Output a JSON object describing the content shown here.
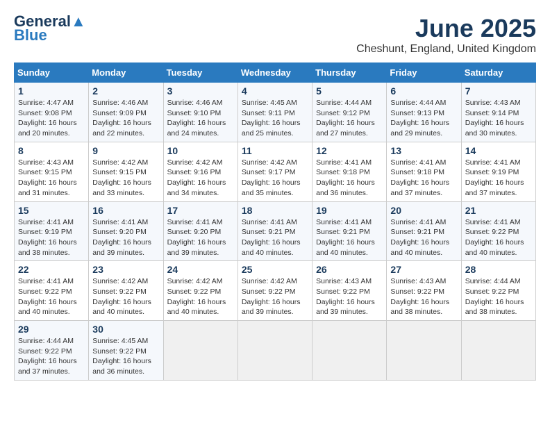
{
  "header": {
    "logo_line1": "General",
    "logo_line2": "Blue",
    "title": "June 2025",
    "subtitle": "Cheshunt, England, United Kingdom"
  },
  "columns": [
    "Sunday",
    "Monday",
    "Tuesday",
    "Wednesday",
    "Thursday",
    "Friday",
    "Saturday"
  ],
  "rows": [
    [
      {
        "day": "1",
        "info": "Sunrise: 4:47 AM\nSunset: 9:08 PM\nDaylight: 16 hours\nand 20 minutes."
      },
      {
        "day": "2",
        "info": "Sunrise: 4:46 AM\nSunset: 9:09 PM\nDaylight: 16 hours\nand 22 minutes."
      },
      {
        "day": "3",
        "info": "Sunrise: 4:46 AM\nSunset: 9:10 PM\nDaylight: 16 hours\nand 24 minutes."
      },
      {
        "day": "4",
        "info": "Sunrise: 4:45 AM\nSunset: 9:11 PM\nDaylight: 16 hours\nand 25 minutes."
      },
      {
        "day": "5",
        "info": "Sunrise: 4:44 AM\nSunset: 9:12 PM\nDaylight: 16 hours\nand 27 minutes."
      },
      {
        "day": "6",
        "info": "Sunrise: 4:44 AM\nSunset: 9:13 PM\nDaylight: 16 hours\nand 29 minutes."
      },
      {
        "day": "7",
        "info": "Sunrise: 4:43 AM\nSunset: 9:14 PM\nDaylight: 16 hours\nand 30 minutes."
      }
    ],
    [
      {
        "day": "8",
        "info": "Sunrise: 4:43 AM\nSunset: 9:15 PM\nDaylight: 16 hours\nand 31 minutes."
      },
      {
        "day": "9",
        "info": "Sunrise: 4:42 AM\nSunset: 9:15 PM\nDaylight: 16 hours\nand 33 minutes."
      },
      {
        "day": "10",
        "info": "Sunrise: 4:42 AM\nSunset: 9:16 PM\nDaylight: 16 hours\nand 34 minutes."
      },
      {
        "day": "11",
        "info": "Sunrise: 4:42 AM\nSunset: 9:17 PM\nDaylight: 16 hours\nand 35 minutes."
      },
      {
        "day": "12",
        "info": "Sunrise: 4:41 AM\nSunset: 9:18 PM\nDaylight: 16 hours\nand 36 minutes."
      },
      {
        "day": "13",
        "info": "Sunrise: 4:41 AM\nSunset: 9:18 PM\nDaylight: 16 hours\nand 37 minutes."
      },
      {
        "day": "14",
        "info": "Sunrise: 4:41 AM\nSunset: 9:19 PM\nDaylight: 16 hours\nand 37 minutes."
      }
    ],
    [
      {
        "day": "15",
        "info": "Sunrise: 4:41 AM\nSunset: 9:19 PM\nDaylight: 16 hours\nand 38 minutes."
      },
      {
        "day": "16",
        "info": "Sunrise: 4:41 AM\nSunset: 9:20 PM\nDaylight: 16 hours\nand 39 minutes."
      },
      {
        "day": "17",
        "info": "Sunrise: 4:41 AM\nSunset: 9:20 PM\nDaylight: 16 hours\nand 39 minutes."
      },
      {
        "day": "18",
        "info": "Sunrise: 4:41 AM\nSunset: 9:21 PM\nDaylight: 16 hours\nand 40 minutes."
      },
      {
        "day": "19",
        "info": "Sunrise: 4:41 AM\nSunset: 9:21 PM\nDaylight: 16 hours\nand 40 minutes."
      },
      {
        "day": "20",
        "info": "Sunrise: 4:41 AM\nSunset: 9:21 PM\nDaylight: 16 hours\nand 40 minutes."
      },
      {
        "day": "21",
        "info": "Sunrise: 4:41 AM\nSunset: 9:22 PM\nDaylight: 16 hours\nand 40 minutes."
      }
    ],
    [
      {
        "day": "22",
        "info": "Sunrise: 4:41 AM\nSunset: 9:22 PM\nDaylight: 16 hours\nand 40 minutes."
      },
      {
        "day": "23",
        "info": "Sunrise: 4:42 AM\nSunset: 9:22 PM\nDaylight: 16 hours\nand 40 minutes."
      },
      {
        "day": "24",
        "info": "Sunrise: 4:42 AM\nSunset: 9:22 PM\nDaylight: 16 hours\nand 40 minutes."
      },
      {
        "day": "25",
        "info": "Sunrise: 4:42 AM\nSunset: 9:22 PM\nDaylight: 16 hours\nand 39 minutes."
      },
      {
        "day": "26",
        "info": "Sunrise: 4:43 AM\nSunset: 9:22 PM\nDaylight: 16 hours\nand 39 minutes."
      },
      {
        "day": "27",
        "info": "Sunrise: 4:43 AM\nSunset: 9:22 PM\nDaylight: 16 hours\nand 38 minutes."
      },
      {
        "day": "28",
        "info": "Sunrise: 4:44 AM\nSunset: 9:22 PM\nDaylight: 16 hours\nand 38 minutes."
      }
    ],
    [
      {
        "day": "29",
        "info": "Sunrise: 4:44 AM\nSunset: 9:22 PM\nDaylight: 16 hours\nand 37 minutes."
      },
      {
        "day": "30",
        "info": "Sunrise: 4:45 AM\nSunset: 9:22 PM\nDaylight: 16 hours\nand 36 minutes."
      },
      null,
      null,
      null,
      null,
      null
    ]
  ]
}
